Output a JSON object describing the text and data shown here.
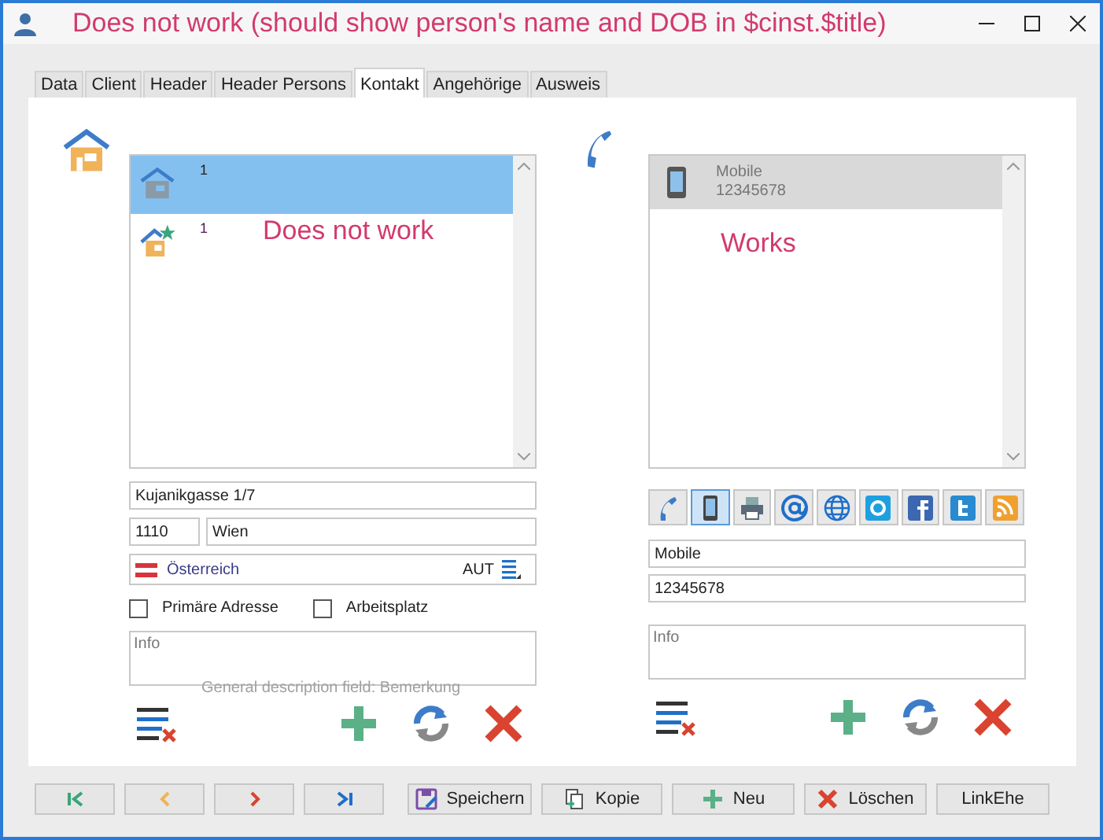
{
  "window": {
    "title": "Does not work (should show person's name and DOB in $cinst.$title)"
  },
  "tabs": [
    {
      "label": "Data",
      "selected": false
    },
    {
      "label": "Client",
      "selected": false
    },
    {
      "label": "Header",
      "selected": false
    },
    {
      "label": "Header Persons",
      "selected": false
    },
    {
      "label": "Kontakt",
      "selected": true
    },
    {
      "label": "Angehörige",
      "selected": false
    },
    {
      "label": "Ausweis",
      "selected": false
    }
  ],
  "address": {
    "entries": [
      {
        "kind": "house",
        "number": "1",
        "selected": true
      },
      {
        "kind": "house-star",
        "number": "1",
        "selected": false
      }
    ],
    "note": "Does not work",
    "street": "Kujanikgasse 1/7",
    "zip": "1110",
    "city": "Wien",
    "country": "Österreich",
    "country_code": "AUT",
    "checkboxes": [
      {
        "label": "Primäre Adresse",
        "checked": false
      },
      {
        "label": "Arbeitsplatz",
        "checked": false
      }
    ],
    "info": {
      "placeholder": "Info"
    }
  },
  "contact": {
    "entries": [
      {
        "type": "Mobile",
        "number": "12345678",
        "selected": true
      }
    ],
    "note": "Works",
    "types": [
      {
        "kind": "phone",
        "selected": false
      },
      {
        "kind": "mobile",
        "selected": true
      },
      {
        "kind": "fax",
        "selected": false
      },
      {
        "kind": "email",
        "selected": false
      },
      {
        "kind": "web",
        "selected": false
      },
      {
        "kind": "skype",
        "selected": false
      },
      {
        "kind": "facebook",
        "selected": false
      },
      {
        "kind": "twitter",
        "selected": false
      },
      {
        "kind": "rss",
        "selected": false
      }
    ],
    "type_value": "Mobile",
    "number_value": "12345678",
    "info": {
      "placeholder": "Info"
    }
  },
  "background_text": "General description field: Bemerkung",
  "buttons": [
    {
      "kind": "first"
    },
    {
      "kind": "previous"
    },
    {
      "kind": "next"
    },
    {
      "kind": "last"
    },
    {
      "kind": "save",
      "label": "Speichern"
    },
    {
      "kind": "copy",
      "label": "Kopie"
    },
    {
      "kind": "new",
      "label": "Neu"
    },
    {
      "kind": "delete",
      "label": "Löschen"
    },
    {
      "kind": "plain",
      "label": "LinkEhe"
    }
  ]
}
